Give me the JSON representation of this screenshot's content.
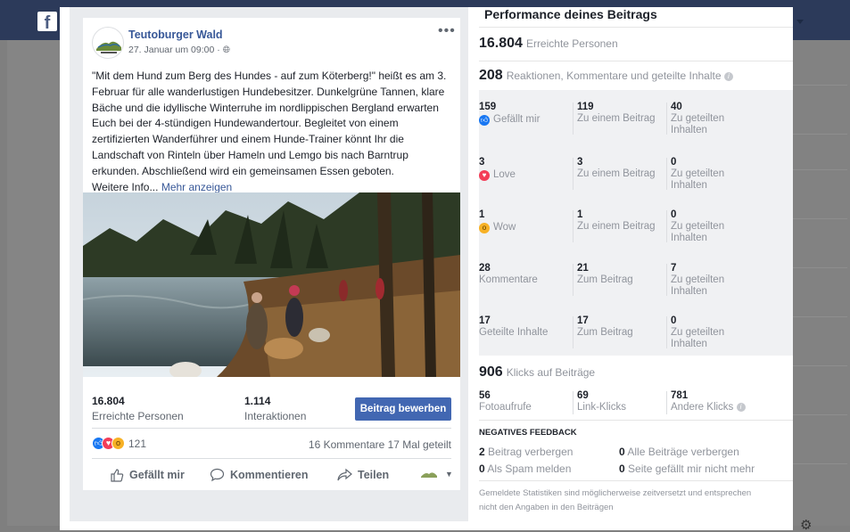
{
  "page": {
    "name": "Teutoburger Wald",
    "date": "27. Januar um 09:00 ·",
    "more_icon": "•••"
  },
  "post": {
    "text": "\"Mit dem Hund zum Berg des Hundes - auf zum Köterberg!\" heißt es am 3. Februar für alle wanderlustigen Hundebesitzer. Dunkelgrüne Tannen, klare Bäche und die idyllische Winterruhe im nordlippischen Bergland erwarten Euch bei der 4-stündigen Hundewandertour. Begleitet von einem zertifizierten Wanderführer und einem Hunde-Trainer könnt Ihr die Landschaft von Rinteln über Hameln und Lemgo bis nach Barntrup erkunden. Abschließend wird ein gemeinsamen Essen geboten.",
    "text_end": "Weitere Info...",
    "more_link": "Mehr anzeigen",
    "reach_value": "16.804",
    "reach_label": "Erreichte Personen",
    "interactions_value": "1.114",
    "interactions_label": "Interaktionen",
    "promote_label": "Beitrag bewerben",
    "reactions_count": "121",
    "comments_shares": "16 Kommentare  17 Mal geteilt",
    "like_label": "Gefällt mir",
    "comment_label": "Kommentieren",
    "share_label": "Teilen"
  },
  "performance": {
    "title": "Performance deines Beitrags",
    "reach_value": "16.804",
    "reach_label": "Erreichte Personen",
    "reactions_value": "208",
    "reactions_label": "Reaktionen, Kommentare und geteilte Inhalte",
    "rows": [
      {
        "c1v": "159",
        "c1l": "Gefällt mir",
        "icon": "like",
        "c2v": "119",
        "c2l": "Zu einem Beitrag",
        "c3v": "40",
        "c3l": "Zu geteilten Inhalten"
      },
      {
        "c1v": "3",
        "c1l": "Love",
        "icon": "love",
        "c2v": "3",
        "c2l": "Zu einem Beitrag",
        "c3v": "0",
        "c3l": "Zu geteilten Inhalten"
      },
      {
        "c1v": "1",
        "c1l": "Wow",
        "icon": "wow",
        "c2v": "1",
        "c2l": "Zu einem Beitrag",
        "c3v": "0",
        "c3l": "Zu geteilten Inhalten"
      },
      {
        "c1v": "28",
        "c1l": "Kommentare",
        "icon": "",
        "c2v": "21",
        "c2l": "Zum Beitrag",
        "c3v": "7",
        "c3l": "Zu geteilten Inhalten"
      },
      {
        "c1v": "17",
        "c1l": "Geteilte Inhalte",
        "icon": "",
        "c2v": "17",
        "c2l": "Zum Beitrag",
        "c3v": "0",
        "c3l": "Zu geteilten Inhalten"
      }
    ],
    "clicks_value": "906",
    "clicks_label": "Klicks auf Beiträge",
    "clicks": [
      {
        "v": "56",
        "l": "Fotoaufrufe"
      },
      {
        "v": "69",
        "l": "Link-Klicks"
      },
      {
        "v": "781",
        "l": "Andere Klicks"
      }
    ],
    "negative_title": "NEGATIVES FEEDBACK",
    "negative": [
      {
        "v": "2",
        "l": "Beitrag verbergen"
      },
      {
        "v": "0",
        "l": "Alle Beiträge verbergen"
      },
      {
        "v": "0",
        "l": "Als Spam melden"
      },
      {
        "v": "0",
        "l": "Seite gefällt mir nicht mehr"
      }
    ],
    "footnote": "Gemeldete Statistiken sind möglicherweise zeitversetzt und entsprechen nicht den Angaben in den Beiträgen"
  },
  "colors": {
    "like": "#1877f2",
    "love": "#f33e58",
    "wow": "#f7b125",
    "link": "#385898",
    "button": "#4267b2"
  }
}
